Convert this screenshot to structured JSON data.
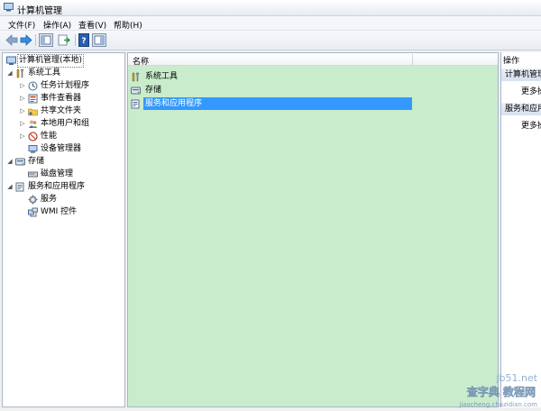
{
  "window": {
    "title": "计算机管理"
  },
  "menu": [
    {
      "label": "文件(F)"
    },
    {
      "label": "操作(A)"
    },
    {
      "label": "查看(V)"
    },
    {
      "label": "帮助(H)"
    }
  ],
  "tree": {
    "root": "计算机管理(本地)",
    "items": [
      {
        "label": "系统工具",
        "level": 1,
        "expand": "open",
        "icon": "tools-icon"
      },
      {
        "label": "任务计划程序",
        "level": 2,
        "expand": "closed",
        "icon": "clock-icon"
      },
      {
        "label": "事件查看器",
        "level": 2,
        "expand": "closed",
        "icon": "event-viewer-icon"
      },
      {
        "label": "共享文件夹",
        "level": 2,
        "expand": "closed",
        "icon": "shared-folder-icon"
      },
      {
        "label": "本地用户和组",
        "level": 2,
        "expand": "closed",
        "icon": "users-icon"
      },
      {
        "label": "性能",
        "level": 2,
        "expand": "closed",
        "icon": "performance-icon"
      },
      {
        "label": "设备管理器",
        "level": 2,
        "expand": "none",
        "icon": "device-manager-icon"
      },
      {
        "label": "存储",
        "level": 1,
        "expand": "open",
        "icon": "storage-icon"
      },
      {
        "label": "磁盘管理",
        "level": 2,
        "expand": "none",
        "icon": "disk-icon"
      },
      {
        "label": "服务和应用程序",
        "level": 1,
        "expand": "open",
        "icon": "services-apps-icon"
      },
      {
        "label": "服务",
        "level": 2,
        "expand": "none",
        "icon": "services-icon"
      },
      {
        "label": "WMI 控件",
        "level": 2,
        "expand": "none",
        "icon": "wmi-icon"
      }
    ]
  },
  "list": {
    "column": "名称",
    "rows": [
      {
        "label": "系统工具",
        "icon": "tools-icon",
        "selected": false
      },
      {
        "label": "存储",
        "icon": "storage-icon",
        "selected": false
      },
      {
        "label": "服务和应用程序",
        "icon": "services-apps-icon",
        "selected": true
      }
    ]
  },
  "actions": {
    "title": "操作",
    "sections": [
      {
        "label": "计算机管理",
        "more": "更多操作"
      },
      {
        "label": "服务和应用程序",
        "more": "更多操作"
      }
    ]
  },
  "watermark": {
    "site": "jb51.net",
    "brand": "查字典 教程网",
    "url": "jiaocheng.chazidian.com"
  }
}
